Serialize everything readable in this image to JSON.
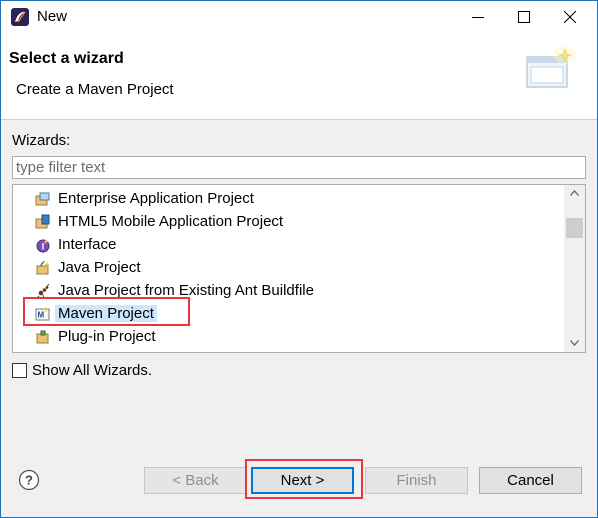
{
  "window": {
    "title": "New",
    "controls": {
      "minimize": "minimize-icon",
      "maximize": "maximize-icon",
      "close": "close-icon"
    }
  },
  "header": {
    "title": "Select a wizard",
    "description": "Create a Maven Project",
    "banner_icon": "wizard-banner-icon"
  },
  "wizards": {
    "label": "Wizards:",
    "filter_placeholder": "type filter text",
    "filter_value": "",
    "items": [
      {
        "label": "Enterprise Application Project",
        "icon": "enterprise-project-icon"
      },
      {
        "label": "HTML5 Mobile Application Project",
        "icon": "html5-project-icon"
      },
      {
        "label": "Interface",
        "icon": "interface-icon"
      },
      {
        "label": "Java Project",
        "icon": "java-project-icon"
      },
      {
        "label": "Java Project from Existing Ant Buildfile",
        "icon": "ant-project-icon"
      },
      {
        "label": "Maven Project",
        "icon": "maven-project-icon",
        "selected": true
      },
      {
        "label": "Plug-in Project",
        "icon": "plugin-project-icon"
      }
    ]
  },
  "show_all": {
    "label": "Show All Wizards.",
    "checked": false
  },
  "buttons": {
    "back": "< Back",
    "next": "Next >",
    "finish": "Finish",
    "cancel": "Cancel"
  },
  "colors": {
    "highlight_box": "#e8363b",
    "selection": "#cce8ff",
    "window_border": "#1f6fb7"
  }
}
